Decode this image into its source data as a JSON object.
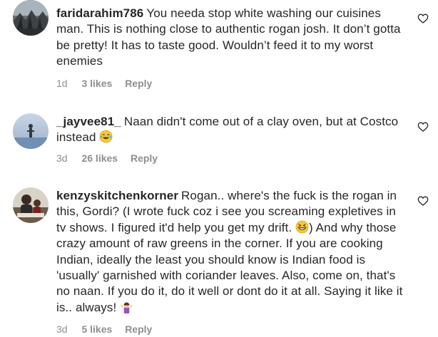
{
  "comments": [
    {
      "username": "faridarahim786",
      "text": "You needa stop white washing our cuisines man. This is nothing close to authentic rogan josh. It don’t gotta be pretty! It has to taste good. Wouldn’t feed it to my worst enemies",
      "time": "1d",
      "likes": "3 likes",
      "reply": "Reply",
      "avatar_icon": "profile-photo"
    },
    {
      "username": "_jayvee81_",
      "text_before_emoji": "Naan didn't come out of a clay oven, but at Costco instead",
      "emoji": "tears-of-joy-emoji",
      "time": "3d",
      "likes": "26 likes",
      "reply": "Reply",
      "avatar_icon": "profile-photo"
    },
    {
      "username": "kenzyskitchenkorner",
      "text_part1": "Rogan.. where's the fuck is the rogan in this, Gordi? (I wrote fuck coz i see you screaming expletives in tv shows. I figured it'd help you get my drift.",
      "emoji1": "grinning-squinting-emoji",
      "text_part2": ") And why those crazy amount of raw greens in the corner. If you are cooking Indian, ideally the least you should know is Indian food is 'usually' garnished with coriander leaves. Also, come on, that's no naan. If you do it, do it well or dont do it at all. Saying it like it is.. always!",
      "emoji2": "person-shrugging-emoji",
      "time": "3d",
      "likes": "5 likes",
      "reply": "Reply",
      "avatar_icon": "profile-photo"
    }
  ],
  "colors": {
    "text": "#262626",
    "secondary": "#8e8e8e",
    "background": "#ffffff"
  }
}
